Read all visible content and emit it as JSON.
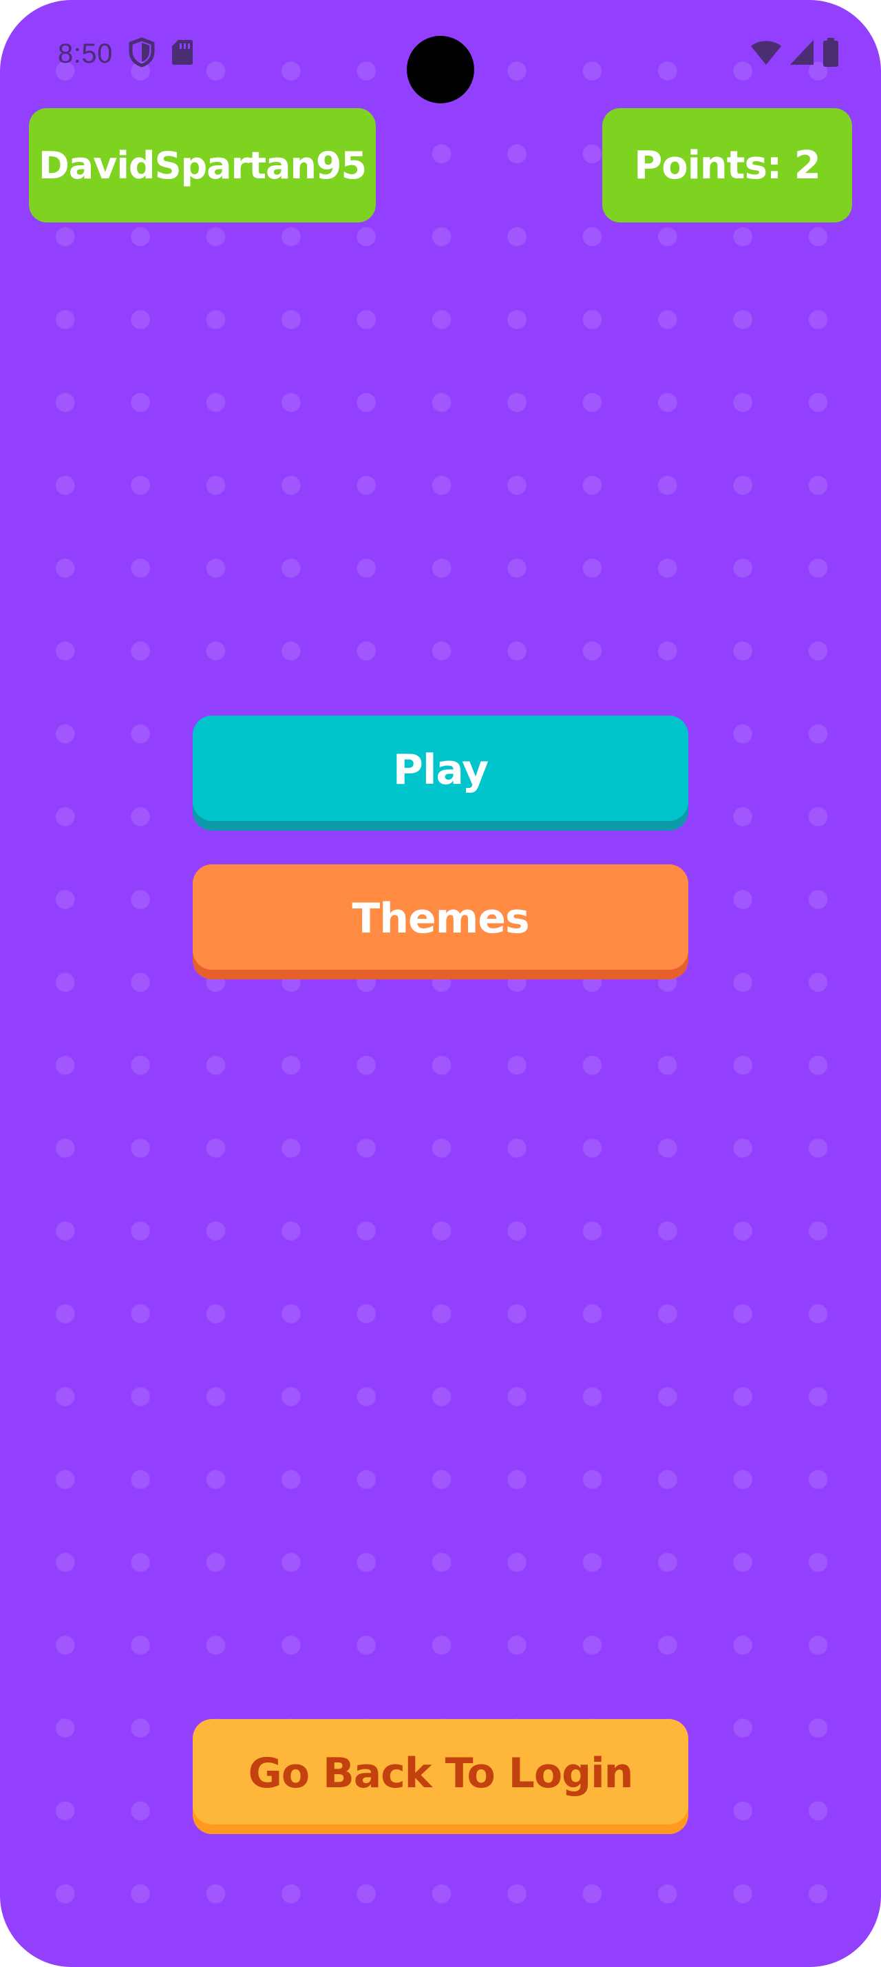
{
  "status_bar": {
    "time": "8:50",
    "left_icons": [
      "shield-icon",
      "sd-card-icon"
    ],
    "right_icons": [
      "wifi-icon",
      "signal-icon",
      "battery-icon"
    ]
  },
  "header": {
    "username": "DavidSpartan95",
    "points_label": "Points: 2"
  },
  "menu": {
    "play_label": "Play",
    "themes_label": "Themes"
  },
  "footer": {
    "back_label": "Go Back To Login"
  },
  "colors": {
    "background": "#923ffe",
    "header_pill": "#7ed321",
    "play": "#00c4cc",
    "themes": "#ff8c42",
    "login": "#ffb73b",
    "login_text": "#c3410f"
  }
}
